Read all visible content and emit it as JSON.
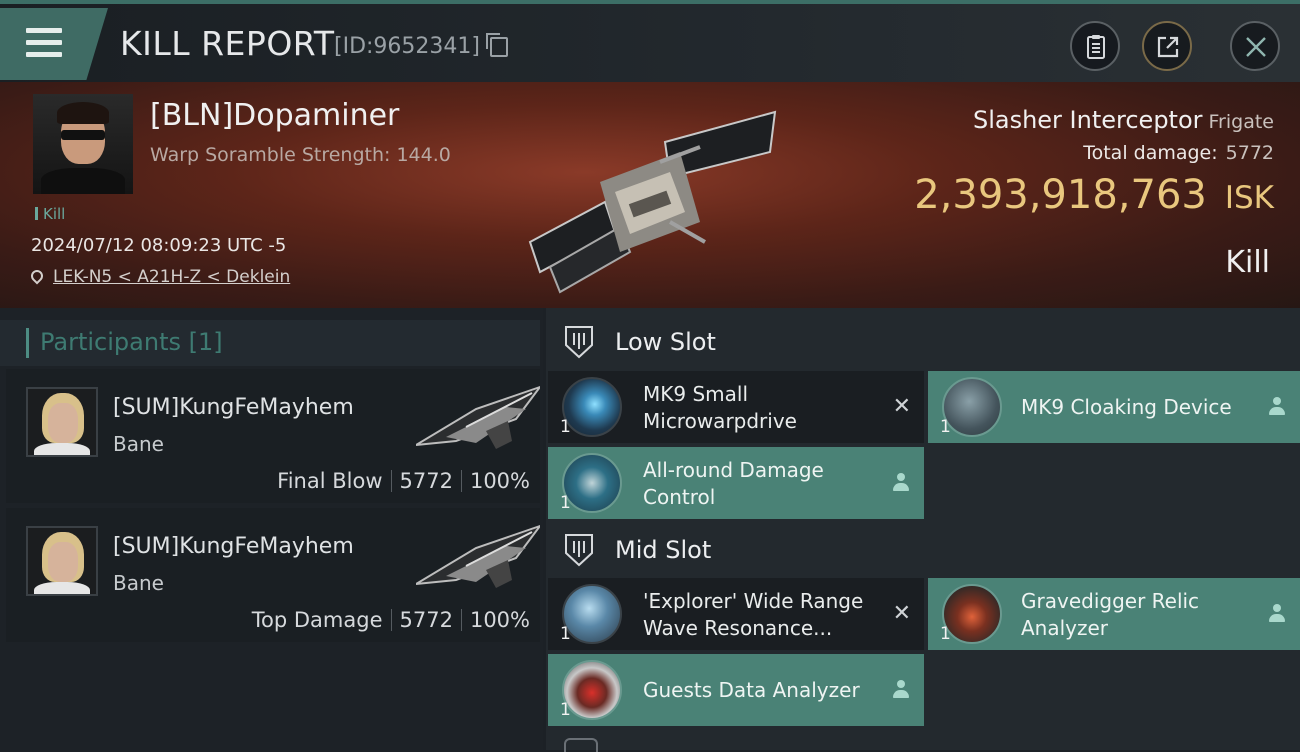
{
  "header": {
    "title": "KILL REPORT",
    "report_id": "[ID:9652341]"
  },
  "victim": {
    "name": "[BLN]Dopaminer",
    "warp_scramble": "Warp Soramble Strength: 144.0",
    "tag": "Kill",
    "timestamp": "2024/07/12 08:09:23 UTC -5",
    "location": "LEK-N5 < A21H-Z < Deklein",
    "ship_name": "Slasher Interceptor",
    "ship_class": "Frigate",
    "total_damage_label": "Total damage:",
    "total_damage": "5772",
    "isk_value": "2,393,918,763",
    "isk_unit": "ISK",
    "result": "Kill"
  },
  "participants": {
    "title": "Participants [1]",
    "rows": [
      {
        "name": "[SUM]KungFeMayhem",
        "ship": "Bane",
        "label": "Final Blow",
        "damage": "5772",
        "percent": "100%"
      },
      {
        "name": "[SUM]KungFeMayhem",
        "ship": "Bane",
        "label": "Top Damage",
        "damage": "5772",
        "percent": "100%"
      }
    ]
  },
  "slots": {
    "low": {
      "title": "Low Slot",
      "modules": [
        {
          "line1": "MK9 Small",
          "line2": "Microwarpdrive",
          "qty": "1",
          "status": "destroyed",
          "icon": "microwarpdrive-icon"
        },
        {
          "line1": "MK9 Cloaking Device",
          "line2": "",
          "qty": "1",
          "status": "dropped",
          "icon": "cloaking-device-icon"
        },
        {
          "line1": "All-round Damage",
          "line2": "Control",
          "qty": "1",
          "status": "dropped",
          "icon": "damage-control-icon"
        }
      ]
    },
    "mid": {
      "title": "Mid Slot",
      "modules": [
        {
          "line1": "'Explorer' Wide Range",
          "line2": "Wave Resonance...",
          "qty": "1",
          "status": "destroyed",
          "icon": "wave-resonance-icon"
        },
        {
          "line1": "Gravedigger Relic",
          "line2": "Analyzer",
          "qty": "1",
          "status": "dropped",
          "icon": "relic-analyzer-icon"
        },
        {
          "line1": "Guests Data Analyzer",
          "line2": "",
          "qty": "1",
          "status": "dropped",
          "icon": "data-analyzer-icon"
        }
      ]
    }
  },
  "colors": {
    "accent_teal": "#4a8276",
    "isk_gold": "#e9c77e",
    "header_teal": "#3f6b64"
  }
}
